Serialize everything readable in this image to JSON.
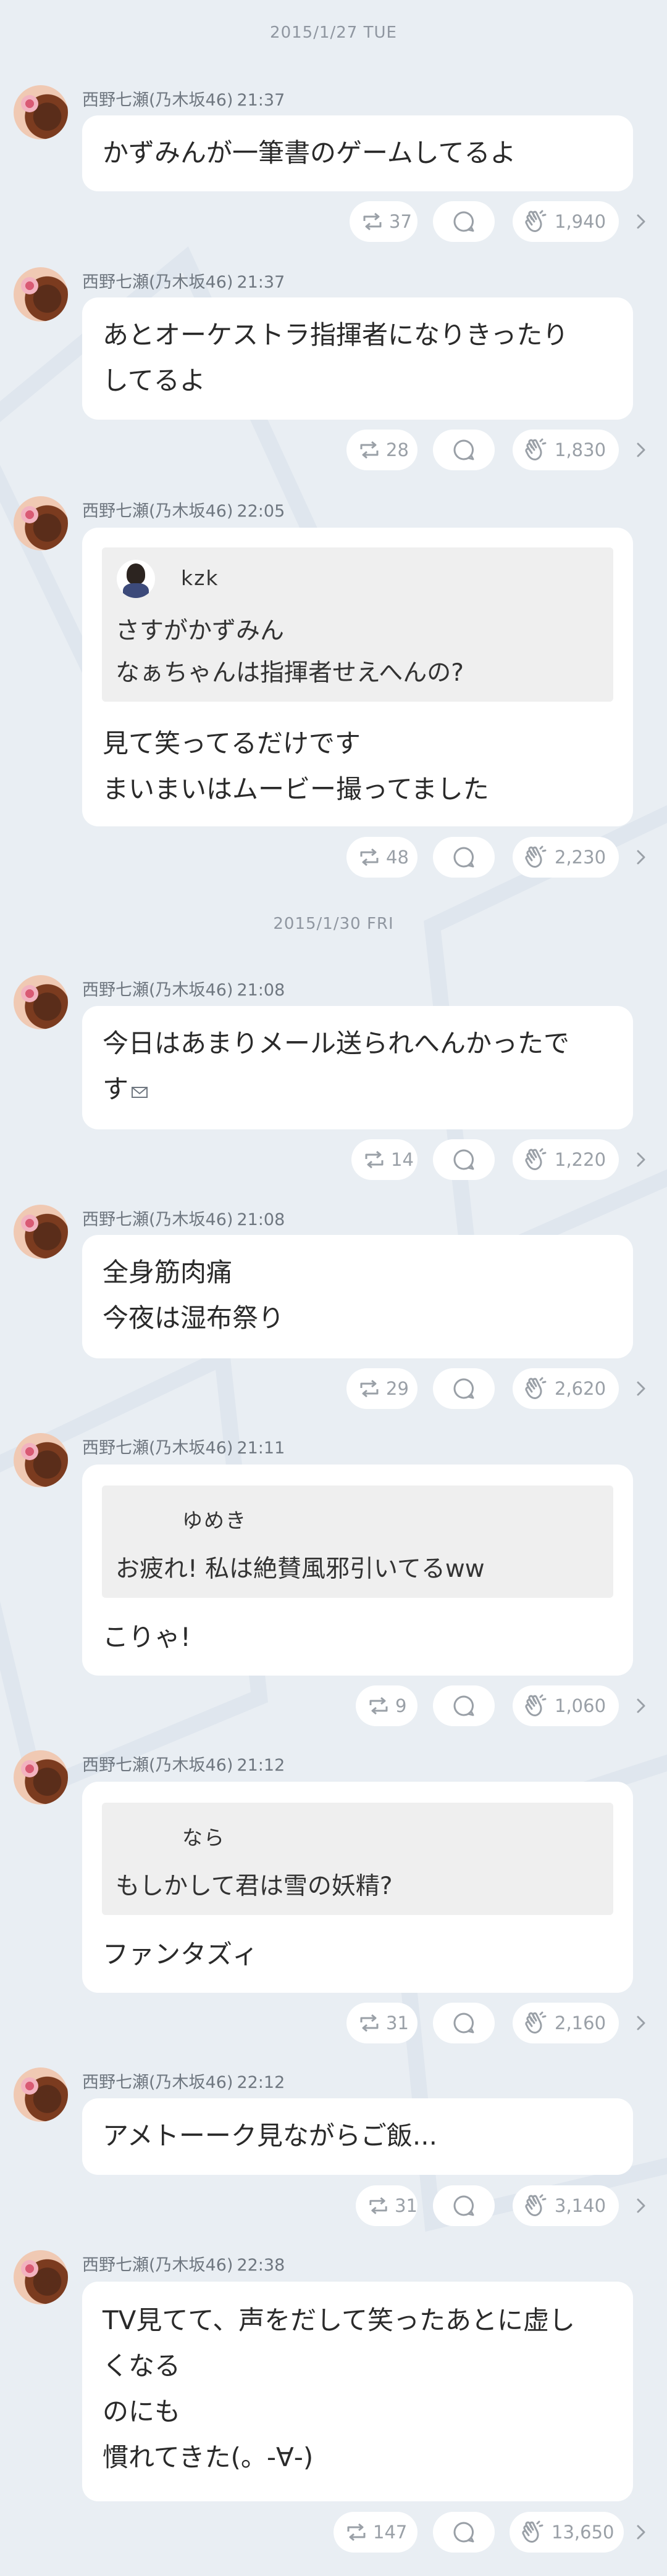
{
  "dates": [
    "2015/1/27 TUE",
    "2015/1/30 FRI"
  ],
  "posts": [
    {
      "sender": "西野七瀬(乃木坂46)",
      "time": "21:37",
      "lines": [
        "かずみんが一筆書のゲームしてるよ"
      ],
      "reposts": "37",
      "likes": "1,940"
    },
    {
      "sender": "西野七瀬(乃木坂46)",
      "time": "21:37",
      "lines": [
        "あとオーケストラ指揮者になりきったり",
        "してるよ"
      ],
      "reposts": "28",
      "likes": "1,830"
    },
    {
      "sender": "西野七瀬(乃木坂46)",
      "time": "22:05",
      "quote": {
        "name": "kzk",
        "lines": [
          "さすがかずみん",
          "なぁちゃんは指揮者せえへんの?"
        ]
      },
      "lines": [
        "見て笑ってるだけです",
        "まいまいはムービー撮ってました"
      ],
      "reposts": "48",
      "likes": "2,230"
    },
    {
      "sender": "西野七瀬(乃木坂46)",
      "time": "21:08",
      "lines": [
        "今日はあまりメール送られへんかったで",
        "す"
      ],
      "reposts": "14",
      "likes": "1,220"
    },
    {
      "sender": "西野七瀬(乃木坂46)",
      "time": "21:08",
      "lines": [
        "全身筋肉痛",
        "今夜は湿布祭り"
      ],
      "reposts": "29",
      "likes": "2,620"
    },
    {
      "sender": "西野七瀬(乃木坂46)",
      "time": "21:11",
      "quote": {
        "name": "ゆめき",
        "lines": [
          "お疲れ! 私は絶賛風邪引いてるww"
        ]
      },
      "lines": [
        "こりゃ!"
      ],
      "reposts": "9",
      "likes": "1,060"
    },
    {
      "sender": "西野七瀬(乃木坂46)",
      "time": "21:12",
      "quote": {
        "name": "なら",
        "lines": [
          "もしかして君は雪の妖精?"
        ]
      },
      "lines": [
        "ファンタズィ"
      ],
      "reposts": "31",
      "likes": "2,160"
    },
    {
      "sender": "西野七瀬(乃木坂46)",
      "time": "22:12",
      "lines": [
        "アメトーーク見ながらご飯..."
      ],
      "reposts": "31",
      "likes": "3,140"
    },
    {
      "sender": "西野七瀬(乃木坂46)",
      "time": "22:38",
      "lines": [
        "TV見てて、声をだして笑ったあとに虚し",
        "くなる",
        "のにも",
        "慣れてきた(。-∀-)"
      ],
      "reposts": "147",
      "likes": "13,650"
    }
  ],
  "icons": {
    "repost": "repost-icon",
    "comment": "comment-icon",
    "like": "clap-icon",
    "more": "chevron-right-icon",
    "mail": "envelope-icon"
  },
  "colors": {
    "background": "#e9eef3",
    "bubble": "#ffffff",
    "quote": "#efefef",
    "muted": "#9aa0a7"
  }
}
